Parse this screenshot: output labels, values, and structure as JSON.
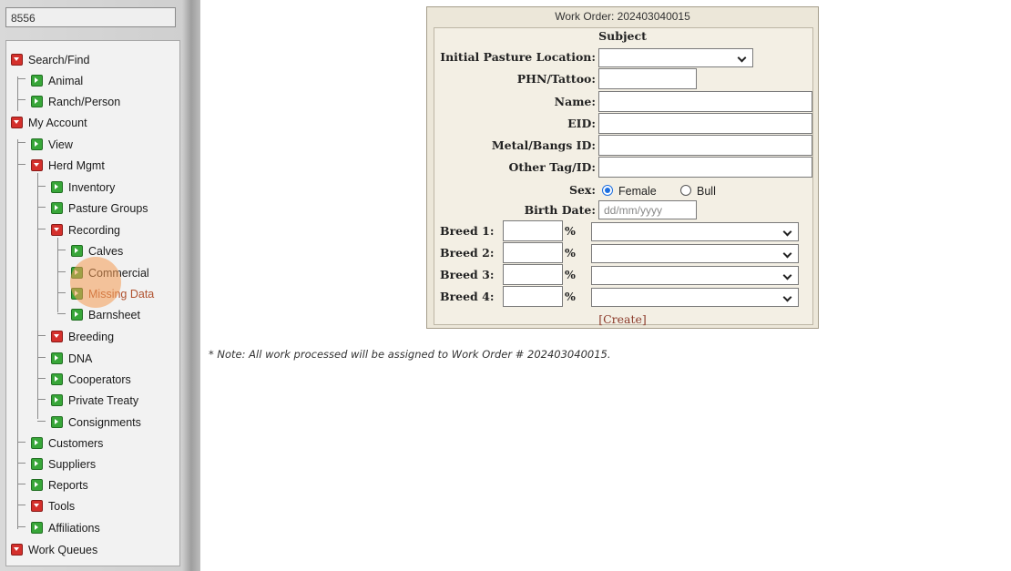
{
  "sidebar": {
    "search_value": "8556",
    "items": [
      {
        "label": "Search/Find",
        "icon": "collapse-icon"
      },
      {
        "label": "Animal",
        "icon": "expand-icon"
      },
      {
        "label": "Ranch/Person",
        "icon": "expand-icon"
      },
      {
        "label": "My Account",
        "icon": "collapse-icon"
      },
      {
        "label": "View",
        "icon": "expand-icon"
      },
      {
        "label": "Herd Mgmt",
        "icon": "collapse-icon"
      },
      {
        "label": "Inventory",
        "icon": "expand-icon"
      },
      {
        "label": "Pasture Groups",
        "icon": "expand-icon"
      },
      {
        "label": "Recording",
        "icon": "collapse-icon"
      },
      {
        "label": "Calves",
        "icon": "expand-icon"
      },
      {
        "label": "Commercial",
        "icon": "expand-icon"
      },
      {
        "label": "Missing Data",
        "icon": "expand-icon"
      },
      {
        "label": "Barnsheet",
        "icon": "expand-icon"
      },
      {
        "label": "Breeding",
        "icon": "collapse-icon"
      },
      {
        "label": "DNA",
        "icon": "expand-icon"
      },
      {
        "label": "Cooperators",
        "icon": "expand-icon"
      },
      {
        "label": "Private Treaty",
        "icon": "expand-icon"
      },
      {
        "label": "Consignments",
        "icon": "expand-icon"
      },
      {
        "label": "Customers",
        "icon": "expand-icon"
      },
      {
        "label": "Suppliers",
        "icon": "expand-icon"
      },
      {
        "label": "Reports",
        "icon": "expand-icon"
      },
      {
        "label": "Tools",
        "icon": "collapse-icon"
      },
      {
        "label": "Affiliations",
        "icon": "expand-icon"
      },
      {
        "label": "Work Queues",
        "icon": "collapse-icon"
      }
    ]
  },
  "form": {
    "work_order_header": "Work Order:  202403040015",
    "section_title": "Subject",
    "labels": {
      "pasture": "Initial Pasture Location:",
      "phn": "PHN/Tattoo:",
      "name": "Name:",
      "eid": "EID:",
      "metal": "Metal/Bangs ID:",
      "other": "Other Tag/ID:",
      "sex": "Sex:",
      "birth": "Birth Date:"
    },
    "sex_options": [
      "Female",
      "Bull"
    ],
    "sex_selected": "Female",
    "birth_placeholder": "dd/mm/yyyy",
    "breeds": [
      {
        "label": "Breed 1:",
        "pct": "%"
      },
      {
        "label": "Breed 2:",
        "pct": "%"
      },
      {
        "label": "Breed 3:",
        "pct": "%"
      },
      {
        "label": "Breed 4:",
        "pct": "%"
      }
    ],
    "create_open": "[",
    "create_label": "Create",
    "create_close": "]"
  },
  "note": "* Note: All work processed will be assigned to Work Order # 202403040015."
}
